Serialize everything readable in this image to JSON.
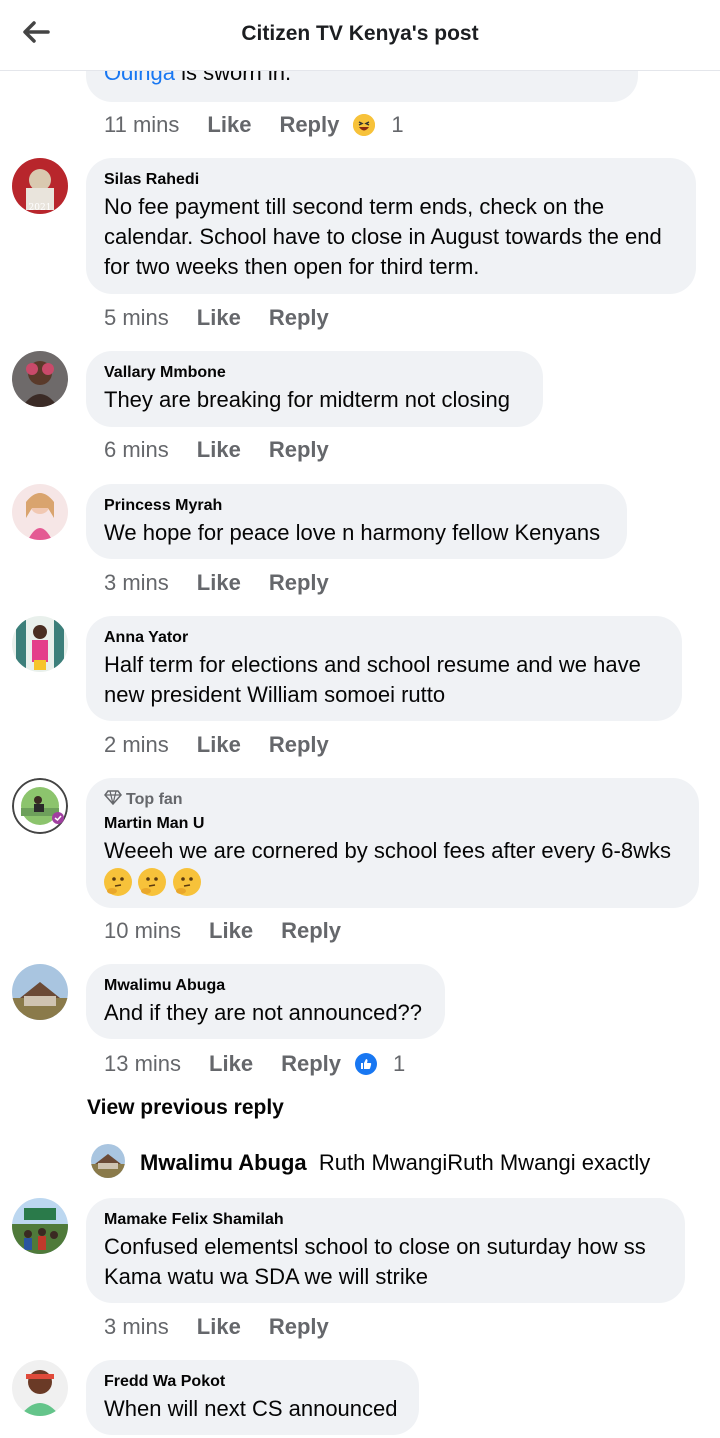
{
  "header": {
    "title": "Citizen TV Kenya's post"
  },
  "top_partial": {
    "link_text": "Odinga",
    "text": " is sworn in.",
    "time": "11 mins",
    "like": "Like",
    "reply": "Reply",
    "reaction_count": "1"
  },
  "comments": [
    {
      "author": "Silas Rahedi",
      "text": "No fee payment till second term ends, check on the calendar. School have to close in August towards the end for two weeks then open for third term.",
      "time": "5 mins",
      "like": "Like",
      "reply": "Reply"
    },
    {
      "author": "Vallary Mmbone",
      "text": "They are breaking for midterm not closing",
      "time": "6 mins",
      "like": "Like",
      "reply": "Reply"
    },
    {
      "author": "Princess Myrah",
      "text": "We hope for peace love n harmony fellow Kenyans",
      "time": "3 mins",
      "like": "Like",
      "reply": "Reply"
    },
    {
      "author": "Anna Yator",
      "text": "Half term for elections and school resume and  we have new president  William somoei rutto",
      "time": "2 mins",
      "like": "Like",
      "reply": "Reply"
    },
    {
      "badge": "Top fan",
      "author": "Martin Man U",
      "text": "Weeeh we are cornered by school fees after every 6-8wks",
      "time": "10 mins",
      "like": "Like",
      "reply": "Reply"
    },
    {
      "author": "Mwalimu Abuga",
      "text": "And if they are not announced??",
      "time": "13 mins",
      "like": "Like",
      "reply": "Reply",
      "reaction_count": "1"
    },
    {
      "author": "Mamake Felix Shamilah",
      "text": "Confused elementsl school to close on suturday how ss Kama watu wa SDA we will strike",
      "time": "3 mins",
      "like": "Like",
      "reply": "Reply"
    },
    {
      "author": "Fredd Wa Pokot",
      "text": "When will next CS announced"
    }
  ],
  "view_previous": "View previous reply",
  "reply_preview": {
    "author": "Mwalimu Abuga",
    "text": "Ruth MwangiRuth Mwangi exactly"
  },
  "colors": {
    "bubble": "#f0f2f5",
    "meta": "#65676b",
    "link": "#1877f2",
    "like_blue": "#1877f2"
  }
}
